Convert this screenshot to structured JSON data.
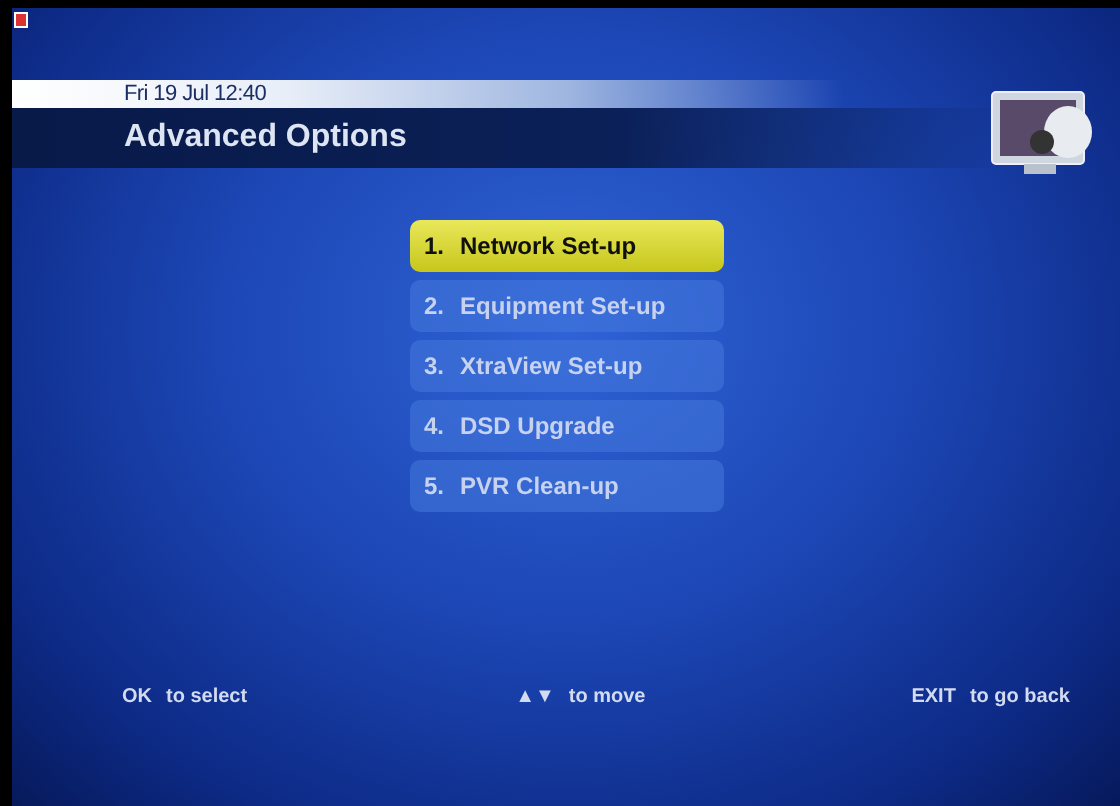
{
  "header": {
    "date_time": "Fri 19 Jul 12:40",
    "title": "Advanced Options"
  },
  "menu": [
    {
      "number": "1.",
      "label": "Network Set-up",
      "selected": true
    },
    {
      "number": "2.",
      "label": "Equipment Set-up",
      "selected": false
    },
    {
      "number": "3.",
      "label": "XtraView Set-up",
      "selected": false
    },
    {
      "number": "4.",
      "label": "DSD Upgrade",
      "selected": false
    },
    {
      "number": "5.",
      "label": "PVR Clean-up",
      "selected": false
    }
  ],
  "footer": [
    {
      "key": "OK",
      "text": "to select"
    },
    {
      "key": "▲▼",
      "text": "to move"
    },
    {
      "key": "EXIT",
      "text": "to go back"
    }
  ]
}
